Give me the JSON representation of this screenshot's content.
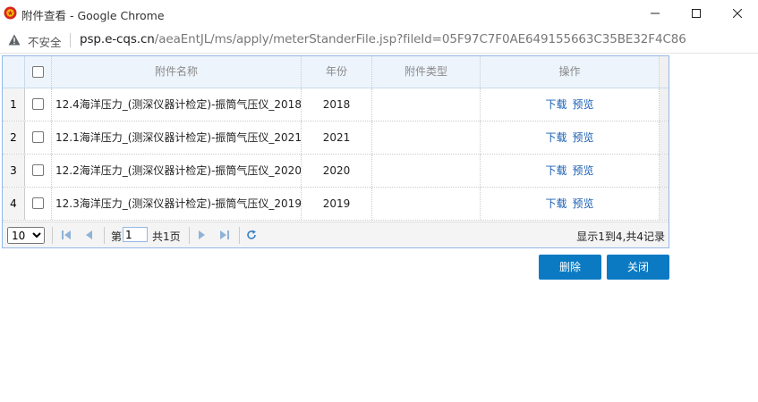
{
  "window": {
    "title": "附件查看 - Google Chrome",
    "icon": "emblem-icon"
  },
  "address_bar": {
    "security_label": "不安全",
    "url_host": "psp.e-cqs.cn",
    "url_path": "/aeaEntJL/ms/apply/meterStanderFile.jsp?fileId=05F97C7F0AE649155663C35BE32F4C86"
  },
  "grid": {
    "columns": [
      "附件名称",
      "年份",
      "附件类型",
      "操作"
    ],
    "rows": [
      {
        "num": "1",
        "name": "12.4海洋压力_(测深仪器计检定)-振筒气压仪_2018",
        "year": "2018",
        "type": "",
        "download": "下载",
        "preview": "预览"
      },
      {
        "num": "2",
        "name": "12.1海洋压力_(测深仪器计检定)-振筒气压仪_2021",
        "year": "2021",
        "type": "",
        "download": "下载",
        "preview": "预览"
      },
      {
        "num": "3",
        "name": "12.2海洋压力_(测深仪器计检定)-振筒气压仪_2020",
        "year": "2020",
        "type": "",
        "download": "下载",
        "preview": "预览"
      },
      {
        "num": "4",
        "name": "12.3海洋压力_(测深仪器计检定)-振筒气压仪_2019",
        "year": "2019",
        "type": "",
        "download": "下载",
        "preview": "预览"
      }
    ]
  },
  "pager": {
    "page_size": "10",
    "page_size_options": [
      "10"
    ],
    "page_prefix": "第",
    "page_value": "1",
    "page_suffix": "共1页",
    "info": "显示1到4,共4记录"
  },
  "buttons": {
    "delete": "删除",
    "close": "关闭"
  },
  "colors": {
    "header_bg": "#edf4fc",
    "border": "#95b8e7",
    "link": "#1a5fb4",
    "button": "#0b7ac3"
  }
}
